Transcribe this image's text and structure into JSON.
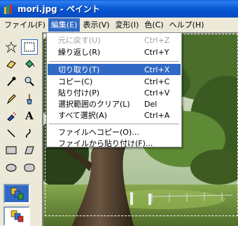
{
  "window": {
    "title": "mori.jpg - ペイント"
  },
  "menubar": {
    "items": [
      "ファイル(F)",
      "編集(E)",
      "表示(V)",
      "変形(I)",
      "色(C)",
      "ヘルプ(H)"
    ]
  },
  "edit_menu": {
    "undo": {
      "label": "元に戻す(U)",
      "shortcut": "Ctrl+Z"
    },
    "redo": {
      "label": "繰り返し(R)",
      "shortcut": "Ctrl+Y"
    },
    "cut": {
      "label": "切り取り(T)",
      "shortcut": "Ctrl+X"
    },
    "copy": {
      "label": "コピー(C)",
      "shortcut": "Ctrl+C"
    },
    "paste": {
      "label": "貼り付け(P)",
      "shortcut": "Ctrl+V"
    },
    "clear": {
      "label": "選択範囲のクリア(L)",
      "shortcut": "Del"
    },
    "select_all": {
      "label": "すべて選択(A)",
      "shortcut": "Ctrl+A"
    },
    "copy_to": {
      "label": "ファイルへコピー(O)..."
    },
    "paste_from": {
      "label": "ファイルから貼り付け(F)..."
    }
  },
  "tools": [
    "free-form-select-icon",
    "rectangle-select-icon",
    "eraser-icon",
    "fill-bucket-icon",
    "color-picker-icon",
    "magnifier-icon",
    "pencil-icon",
    "brush-icon",
    "airbrush-icon",
    "text-icon",
    "line-icon",
    "curve-icon",
    "rectangle-icon",
    "polygon-icon",
    "ellipse-icon",
    "rounded-rectangle-icon"
  ],
  "tool_text_glyph": "A",
  "colors": {
    "titlebar": "#0a5fd8",
    "highlight": "#316ac5",
    "face": "#ece9d8"
  }
}
